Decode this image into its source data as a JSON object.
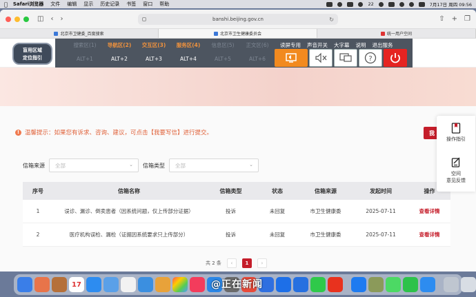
{
  "menubar": {
    "app": "Safari浏览器",
    "items": [
      "文件",
      "编辑",
      "显示",
      "历史记录",
      "书签",
      "窗口",
      "帮助"
    ],
    "status": {
      "counter": "22",
      "datetime": "7月17日 周四 09:56"
    }
  },
  "browser": {
    "url": "banshi.beijing.gov.cn",
    "tabs": [
      {
        "label": "北京市卫健委_百度搜索",
        "active": false
      },
      {
        "label": "北京市卫生健康委员会",
        "active": true
      },
      {
        "label": "统一用户空间",
        "active": false
      }
    ]
  },
  "a11y": {
    "logo_line1": "盲用区域",
    "logo_line2": "定位指引",
    "zones": [
      {
        "label": "搜索区(1)",
        "key": "ALT+1",
        "state": "dim"
      },
      {
        "label": "导航区(2)",
        "key": "ALT+2",
        "state": "on"
      },
      {
        "label": "交互区(3)",
        "key": "ALT+3",
        "state": "on"
      },
      {
        "label": "服务区(4)",
        "key": "ALT+4",
        "state": "on"
      },
      {
        "label": "信息区(5)",
        "key": "ALT+5",
        "state": "dim"
      },
      {
        "label": "正文区(6)",
        "key": "ALT+6",
        "state": "dim"
      }
    ],
    "links": [
      "读屏专用",
      "声音开关",
      "大字幕",
      "说明",
      "退出服务"
    ]
  },
  "notice": {
    "text": "温馨提示：如果您有诉求、咨询、建议，可点击【我要写信】进行提交。",
    "write_button": "我"
  },
  "filters": {
    "source_label": "信箱来源",
    "source_placeholder": "全部",
    "type_label": "信箱类型",
    "type_placeholder": "全部"
  },
  "table": {
    "headers": [
      "序号",
      "信箱名称",
      "信箱类型",
      "状态",
      "信箱来源",
      "发起时间",
      "操作"
    ],
    "rows": [
      {
        "no": "1",
        "name": "误诊、漏诊、倒卖患者（因系统问题，仅上传部分证据）",
        "type": "投诉",
        "status": "未回复",
        "source": "市卫生健康委",
        "date": "2025-07-11",
        "action": "查看详情"
      },
      {
        "no": "2",
        "name": "医疗机构误检、漏检（证据因系统要求只上传部分）",
        "type": "投诉",
        "status": "未回复",
        "source": "市卫生健康委",
        "date": "2025-07-11",
        "action": "查看详情"
      }
    ]
  },
  "pager": {
    "total": "共 2 条",
    "prev": "‹",
    "current": "1",
    "next": "›"
  },
  "side": {
    "guide": "操作指引",
    "feedback_line1": "空间",
    "feedback_line2": "意见反馈"
  },
  "dock": {
    "calendar_day": "17",
    "watermark": "@正在新闻"
  },
  "colors": {
    "accent_red": "#c51d2a",
    "zone_orange": "#f0923d",
    "notice_orange": "#e0623a",
    "panel_gray": "#4d5560"
  }
}
